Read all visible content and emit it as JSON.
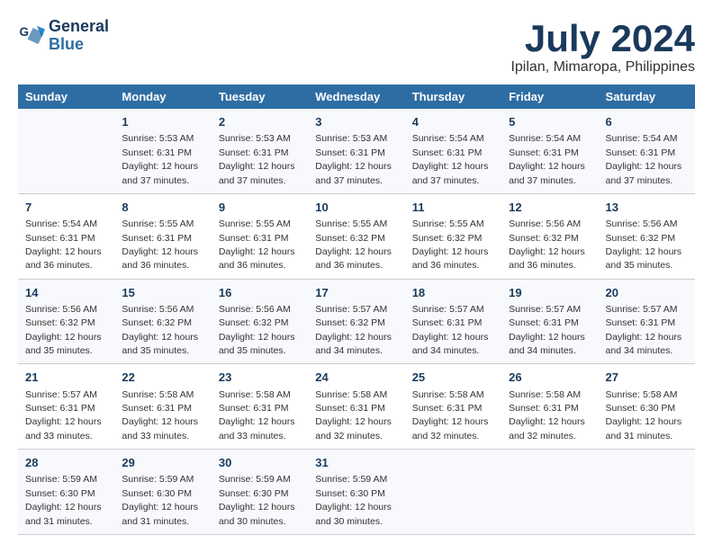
{
  "header": {
    "logo_line1": "General",
    "logo_line2": "Blue",
    "month_title": "July 2024",
    "location": "Ipilan, Mimaropa, Philippines"
  },
  "weekdays": [
    "Sunday",
    "Monday",
    "Tuesday",
    "Wednesday",
    "Thursday",
    "Friday",
    "Saturday"
  ],
  "weeks": [
    [
      null,
      {
        "day": 1,
        "sunrise": "5:53 AM",
        "sunset": "6:31 PM",
        "daylight": "12 hours and 37 minutes."
      },
      {
        "day": 2,
        "sunrise": "5:53 AM",
        "sunset": "6:31 PM",
        "daylight": "12 hours and 37 minutes."
      },
      {
        "day": 3,
        "sunrise": "5:53 AM",
        "sunset": "6:31 PM",
        "daylight": "12 hours and 37 minutes."
      },
      {
        "day": 4,
        "sunrise": "5:54 AM",
        "sunset": "6:31 PM",
        "daylight": "12 hours and 37 minutes."
      },
      {
        "day": 5,
        "sunrise": "5:54 AM",
        "sunset": "6:31 PM",
        "daylight": "12 hours and 37 minutes."
      },
      {
        "day": 6,
        "sunrise": "5:54 AM",
        "sunset": "6:31 PM",
        "daylight": "12 hours and 37 minutes."
      }
    ],
    [
      {
        "day": 7,
        "sunrise": "5:54 AM",
        "sunset": "6:31 PM",
        "daylight": "12 hours and 36 minutes."
      },
      {
        "day": 8,
        "sunrise": "5:55 AM",
        "sunset": "6:31 PM",
        "daylight": "12 hours and 36 minutes."
      },
      {
        "day": 9,
        "sunrise": "5:55 AM",
        "sunset": "6:31 PM",
        "daylight": "12 hours and 36 minutes."
      },
      {
        "day": 10,
        "sunrise": "5:55 AM",
        "sunset": "6:32 PM",
        "daylight": "12 hours and 36 minutes."
      },
      {
        "day": 11,
        "sunrise": "5:55 AM",
        "sunset": "6:32 PM",
        "daylight": "12 hours and 36 minutes."
      },
      {
        "day": 12,
        "sunrise": "5:56 AM",
        "sunset": "6:32 PM",
        "daylight": "12 hours and 36 minutes."
      },
      {
        "day": 13,
        "sunrise": "5:56 AM",
        "sunset": "6:32 PM",
        "daylight": "12 hours and 35 minutes."
      }
    ],
    [
      {
        "day": 14,
        "sunrise": "5:56 AM",
        "sunset": "6:32 PM",
        "daylight": "12 hours and 35 minutes."
      },
      {
        "day": 15,
        "sunrise": "5:56 AM",
        "sunset": "6:32 PM",
        "daylight": "12 hours and 35 minutes."
      },
      {
        "day": 16,
        "sunrise": "5:56 AM",
        "sunset": "6:32 PM",
        "daylight": "12 hours and 35 minutes."
      },
      {
        "day": 17,
        "sunrise": "5:57 AM",
        "sunset": "6:32 PM",
        "daylight": "12 hours and 34 minutes."
      },
      {
        "day": 18,
        "sunrise": "5:57 AM",
        "sunset": "6:31 PM",
        "daylight": "12 hours and 34 minutes."
      },
      {
        "day": 19,
        "sunrise": "5:57 AM",
        "sunset": "6:31 PM",
        "daylight": "12 hours and 34 minutes."
      },
      {
        "day": 20,
        "sunrise": "5:57 AM",
        "sunset": "6:31 PM",
        "daylight": "12 hours and 34 minutes."
      }
    ],
    [
      {
        "day": 21,
        "sunrise": "5:57 AM",
        "sunset": "6:31 PM",
        "daylight": "12 hours and 33 minutes."
      },
      {
        "day": 22,
        "sunrise": "5:58 AM",
        "sunset": "6:31 PM",
        "daylight": "12 hours and 33 minutes."
      },
      {
        "day": 23,
        "sunrise": "5:58 AM",
        "sunset": "6:31 PM",
        "daylight": "12 hours and 33 minutes."
      },
      {
        "day": 24,
        "sunrise": "5:58 AM",
        "sunset": "6:31 PM",
        "daylight": "12 hours and 32 minutes."
      },
      {
        "day": 25,
        "sunrise": "5:58 AM",
        "sunset": "6:31 PM",
        "daylight": "12 hours and 32 minutes."
      },
      {
        "day": 26,
        "sunrise": "5:58 AM",
        "sunset": "6:31 PM",
        "daylight": "12 hours and 32 minutes."
      },
      {
        "day": 27,
        "sunrise": "5:58 AM",
        "sunset": "6:30 PM",
        "daylight": "12 hours and 31 minutes."
      }
    ],
    [
      {
        "day": 28,
        "sunrise": "5:59 AM",
        "sunset": "6:30 PM",
        "daylight": "12 hours and 31 minutes."
      },
      {
        "day": 29,
        "sunrise": "5:59 AM",
        "sunset": "6:30 PM",
        "daylight": "12 hours and 31 minutes."
      },
      {
        "day": 30,
        "sunrise": "5:59 AM",
        "sunset": "6:30 PM",
        "daylight": "12 hours and 30 minutes."
      },
      {
        "day": 31,
        "sunrise": "5:59 AM",
        "sunset": "6:30 PM",
        "daylight": "12 hours and 30 minutes."
      },
      null,
      null,
      null
    ]
  ]
}
